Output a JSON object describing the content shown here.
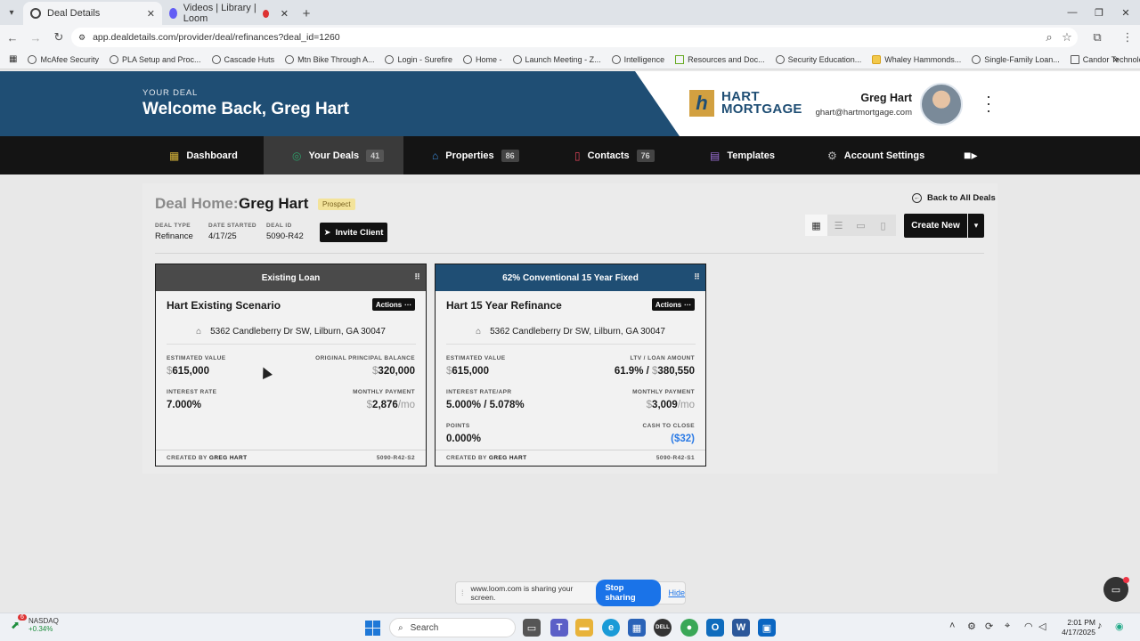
{
  "browser": {
    "tabs": [
      {
        "label": "Deal Details",
        "active": true
      },
      {
        "label": "Videos | Library | Loom",
        "active": false
      }
    ],
    "url": "app.dealdetails.com/provider/deal/refinances?deal_id=1260",
    "bookmarks": [
      "McAfee Security",
      "PLA Setup and Proc...",
      "Cascade Huts",
      "Mtn Bike Through A...",
      "Login - Surefire",
      "Home -",
      "Launch Meeting - Z...",
      "Intelligence",
      "Resources and Doc...",
      "Security Education...",
      "Whaley Hammonds...",
      "Single-Family Loan...",
      "Candor Technologi..."
    ]
  },
  "header": {
    "kicker": "YOUR DEAL",
    "title": "Welcome Back, Greg Hart",
    "logo_mark": "h",
    "logo_line1": "HART",
    "logo_line2": "MORTGAGE",
    "user_name": "Greg Hart",
    "user_email": "ghart@hartmortgage.com"
  },
  "nav": {
    "dashboard": {
      "label": "Dashboard"
    },
    "deals": {
      "label": "Your Deals",
      "count": "41"
    },
    "properties": {
      "label": "Properties",
      "count": "86"
    },
    "contacts": {
      "label": "Contacts",
      "count": "76"
    },
    "templates": {
      "label": "Templates"
    },
    "settings": {
      "label": "Account Settings"
    }
  },
  "deal": {
    "label": "Deal Home:",
    "name": "Greg Hart",
    "status": "Prospect",
    "type_label": "DEAL TYPE",
    "type": "Refinance",
    "started_label": "DATE STARTED",
    "started": "4/17/25",
    "id_label": "DEAL ID",
    "id": "5090-R42",
    "invite_label": "Invite Client",
    "back_label": "Back to All Deals",
    "create_label": "Create New"
  },
  "cards": [
    {
      "header": "Existing Loan",
      "header_color": "#4a4a4a",
      "name": "Hart Existing Scenario",
      "actions": "Actions",
      "address": "5362 Candleberry Dr SW, Lilburn, GA 30047",
      "f1k": "ESTIMATED VALUE",
      "f1v": "615,000",
      "f1p": "$",
      "f2k": "ORIGINAL PRINCIPAL BALANCE",
      "f2v": "320,000",
      "f2p": "$",
      "f3k": "INTEREST RATE",
      "f3v": "7.000%",
      "f4k": "MONTHLY PAYMENT",
      "f4v": "2,876",
      "f4p": "$",
      "f4s": "/mo",
      "created_label": "CREATED BY",
      "created_by": "GREG HART",
      "code": "5090-R42-S2"
    },
    {
      "header": "62% Conventional 15 Year Fixed",
      "header_color": "#1f4e74",
      "name": "Hart 15 Year Refinance",
      "actions": "Actions",
      "address": "5362 Candleberry Dr SW, Lilburn, GA 30047",
      "f1k": "ESTIMATED VALUE",
      "f1v": "615,000",
      "f1p": "$",
      "f2k": "LTV / LOAN AMOUNT",
      "f2a": "61.9% / ",
      "f2v": "380,550",
      "f2p": "$",
      "f3k": "INTEREST RATE/APR",
      "f3v": "5.000% / 5.078%",
      "f4k": "MONTHLY PAYMENT",
      "f4v": "3,009",
      "f4p": "$",
      "f4s": "/mo",
      "f5k": "POINTS",
      "f5v": "0.000%",
      "f6k": "CASH TO CLOSE",
      "f6v": "($32)",
      "created_label": "CREATED BY",
      "created_by": "GREG HART",
      "code": "5090-R42-S1"
    }
  ],
  "sharebar": {
    "message": "www.loom.com is sharing your screen.",
    "stop_label": "Stop sharing",
    "hide_label": "Hide"
  },
  "taskbar": {
    "stock_badge": "6",
    "stock_name": "NASDAQ",
    "stock_change": "+0.34%",
    "search_label": "Search",
    "time": "2:01 PM",
    "date": "4/17/2025"
  }
}
